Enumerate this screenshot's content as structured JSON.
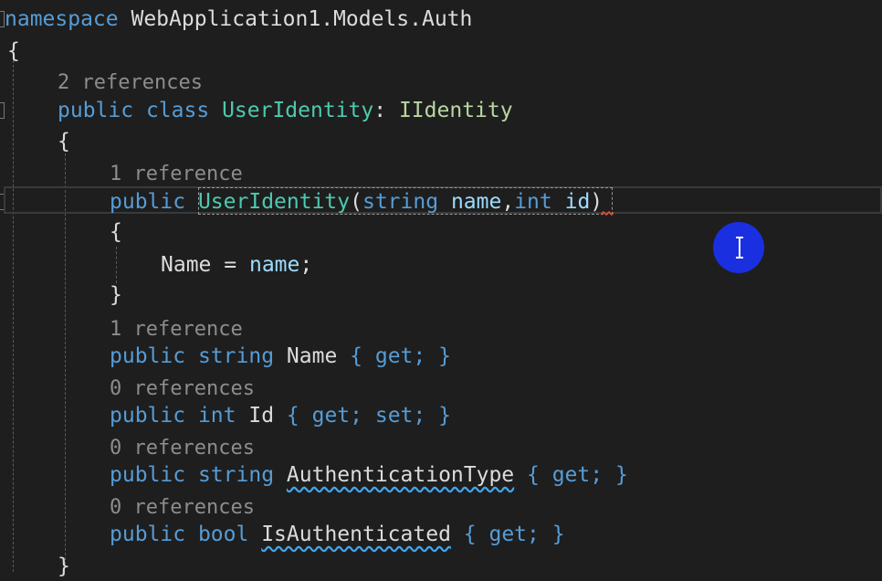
{
  "code": {
    "namespace_keyword": "namespace",
    "namespace_name": "WebApplication1.Models.Auth",
    "open_brace": "{",
    "close_brace": "}",
    "class_lens": "2 references",
    "class_public": "public",
    "class_keyword": "class",
    "class_name": "UserIdentity",
    "class_colon": ":",
    "class_interface": "IIdentity",
    "ctor_lens": "1 reference",
    "ctor_public": "public",
    "ctor_name": "UserIdentity",
    "ctor_open_paren": "(",
    "ctor_param1_type": "string",
    "ctor_param1_name": "name",
    "ctor_comma": ",",
    "ctor_param2_type": "int",
    "ctor_param2_name": "id",
    "ctor_close_paren": ")",
    "ctor_body_lhs": "Name",
    "ctor_body_eq": "=",
    "ctor_body_rhs": "name",
    "ctor_body_semicolon": ";",
    "prop_name_lens": "1 reference",
    "prop_name_modifier": "public",
    "prop_name_type": "string",
    "prop_name_name": "Name",
    "prop_name_accessors": "{ get; }",
    "prop_id_lens": "0 references",
    "prop_id_modifier": "public",
    "prop_id_type": "int",
    "prop_id_name": "Id",
    "prop_id_accessors": "{ get; set; }",
    "prop_authtype_lens": "0 references",
    "prop_authtype_modifier": "public",
    "prop_authtype_type": "string",
    "prop_authtype_name": "AuthenticationType",
    "prop_authtype_accessors": "{ get; }",
    "prop_isauth_lens": "0 references",
    "prop_isauth_modifier": "public",
    "prop_isauth_type": "bool",
    "prop_isauth_name": "IsAuthenticated",
    "prop_isauth_accessors": "{ get; }"
  },
  "colors": {
    "background": "#1e1e1e",
    "keyword": "#569cd6",
    "type": "#4ec9b0",
    "interface": "#b8d7a3",
    "parameter": "#9cdcfe",
    "code_lens": "#8d8d8d",
    "cursor_indicator": "#1a2fe0"
  },
  "icons": {
    "cursor": "text-cursor-ibeam-icon"
  }
}
